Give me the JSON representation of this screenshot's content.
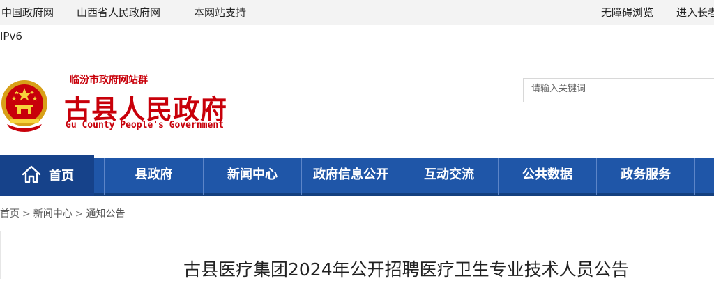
{
  "topbar": {
    "links": [
      "中国政府网",
      "山西省人民政府网",
      "本网站支持"
    ],
    "ipv6": "IPv6",
    "accessibility": "无障碍浏览",
    "elder_mode": "进入长者"
  },
  "header": {
    "site_group": "临汾市政府网站群",
    "title": "古县人民政府",
    "english_title": "Gu County People's Government"
  },
  "search": {
    "placeholder": "请输入关键词"
  },
  "nav": {
    "home": "首页",
    "items": [
      "县政府",
      "新闻中心",
      "政府信息公开",
      "互动交流",
      "公共数据",
      "政务服务"
    ]
  },
  "breadcrumb": [
    "首页",
    "新闻中心",
    "通知公告"
  ],
  "breadcrumb_separator": ">",
  "article": {
    "title": "古县医疗集团2024年公开招聘医疗卫生专业技术人员公告"
  },
  "colors": {
    "brand_red": "#c8000a",
    "nav_blue": "#1f56a8",
    "nav_active": "#16428a"
  }
}
